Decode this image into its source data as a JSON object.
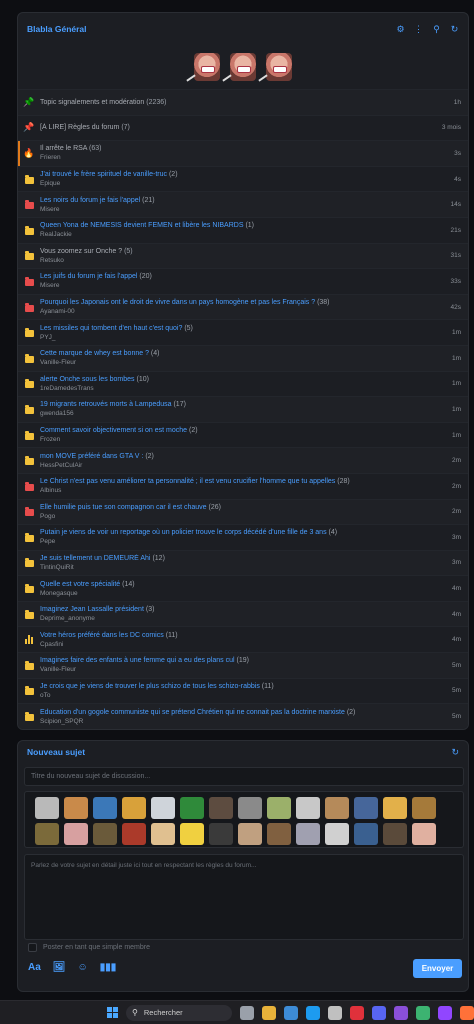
{
  "forum": {
    "title": "Blabla Général",
    "header_icons": [
      "gear-icon",
      "more-vertical-icon",
      "search-icon",
      "refresh-icon"
    ],
    "topics": [
      {
        "icon": "pin-green",
        "title": "Topic signalements et modération",
        "count": "(2236)",
        "author": "",
        "time": "1h",
        "style": "grey"
      },
      {
        "icon": "pin-red",
        "title": "[À LIRE] Règles du forum",
        "count": "(7)",
        "author": "",
        "time": "3 mois",
        "style": "grey"
      },
      {
        "icon": "flame",
        "title": "Il arrête le RSA",
        "count": "(63)",
        "author": "Frieren",
        "time": "3s",
        "style": "grey",
        "active": true
      },
      {
        "icon": "folder-yellow",
        "title": "J'ai trouvé le frère spirituel de vanille-truc",
        "count": "(2)",
        "author": "Epique",
        "time": "4s"
      },
      {
        "icon": "folder-red",
        "title": "Les noirs du forum je fais l'appel",
        "count": "(21)",
        "author": "Misere",
        "time": "14s"
      },
      {
        "icon": "folder-yellow",
        "title": "Queen Yona de NEMESIS devient FEMEN et libère les NIBARDS",
        "count": "(1)",
        "author": "RealJackie",
        "time": "21s"
      },
      {
        "icon": "folder-yellow",
        "title": "Vous zoomez sur Onche ?",
        "count": "(5)",
        "author": "Retsuko",
        "time": "31s",
        "style": "grey"
      },
      {
        "icon": "folder-red",
        "title": "Les juifs du forum je fais l'appel",
        "count": "(20)",
        "author": "Misere",
        "time": "33s"
      },
      {
        "icon": "folder-red",
        "title": "Pourquoi les Japonais ont le droit de vivre dans un pays homogène et pas les Français ?",
        "count": "(38)",
        "author": "Ayanami-00",
        "time": "42s"
      },
      {
        "icon": "folder-yellow",
        "title": "Les missiles qui tombent d'en haut c'est quoi?",
        "count": "(5)",
        "author": "PYJ_",
        "time": "1m"
      },
      {
        "icon": "folder-yellow",
        "title": "Cette marque de whey est bonne ?",
        "count": "(4)",
        "author": "Vanille-Fleur",
        "time": "1m"
      },
      {
        "icon": "folder-yellow",
        "title": "alerte Onche sous les bombes",
        "count": "(10)",
        "author": "1reDamedesTrans",
        "time": "1m"
      },
      {
        "icon": "folder-yellow",
        "title": "19 migrants retrouvés morts à Lampedusa",
        "count": "(17)",
        "author": "gwenda156",
        "time": "1m"
      },
      {
        "icon": "folder-yellow",
        "title": "Comment savoir objectivement si on est moche",
        "count": "(2)",
        "author": "Frozen",
        "time": "1m"
      },
      {
        "icon": "folder-yellow",
        "title": "mon MOVE préféré dans GTA V :",
        "count": "(2)",
        "author": "HessPetCulAir",
        "time": "2m"
      },
      {
        "icon": "folder-red",
        "title": "Le Christ n'est pas venu améliorer ta personnalité ; il est venu crucifier l'homme que tu appelles",
        "count": "(28)",
        "author": "Albinus",
        "time": "2m"
      },
      {
        "icon": "folder-red",
        "title": "Elle humilie puis tue son compagnon car il est chauve",
        "count": "(26)",
        "author": "Pogo",
        "time": "2m"
      },
      {
        "icon": "folder-yellow",
        "title": "Putain je viens de voir un reportage où un policier trouve le corps décédé d'une fille de 3 ans",
        "count": "(4)",
        "author": "Pepe",
        "time": "3m"
      },
      {
        "icon": "folder-yellow",
        "title": "Je suis tellement un DEMEURÉ Ahi",
        "count": "(12)",
        "author": "TintinQuiRit",
        "time": "3m"
      },
      {
        "icon": "folder-yellow",
        "title": "Quelle est votre spécialité",
        "count": "(14)",
        "author": "Monegasque",
        "time": "4m"
      },
      {
        "icon": "folder-yellow",
        "title": "Imaginez Jean Lassalle président",
        "count": "(3)",
        "author": "Deprime_anonyme",
        "time": "4m"
      },
      {
        "icon": "poll",
        "title": "Votre héros préféré dans les DC comics",
        "count": "(11)",
        "author": "Cpasfini",
        "time": "4m"
      },
      {
        "icon": "folder-yellow",
        "title": "Imagines faire des enfants à une femme qui a eu des plans cul",
        "count": "(19)",
        "author": "Vanille-Fleur",
        "time": "5m"
      },
      {
        "icon": "folder-yellow",
        "title": "Je crois que je viens de trouver le plus schizo de tous les schizo-rabbis",
        "count": "(11)",
        "author": "oTo",
        "time": "5m"
      },
      {
        "icon": "folder-yellow",
        "title": "Education d'un gogole communiste qui se prétend Chrétien qui ne connait pas la doctrine marxiste",
        "count": "(2)",
        "author": "Scipion_SPQR",
        "time": "5m"
      }
    ],
    "pager": {
      "prev": "‹",
      "next": "›"
    }
  },
  "new_topic": {
    "title": "Nouveau sujet",
    "title_placeholder": "Titre du nouveau sujet de discussion...",
    "body_placeholder": "Parlez de votre sujet en détail juste ici tout en respectant les règles du forum...",
    "simple_member_label": "Poster en tant que simple membre",
    "tools": [
      "Aa",
      "image-add-icon",
      "emoji-icon",
      "poll-icon"
    ],
    "submit_label": "Envoyer",
    "emoji_colors": [
      "#b9b9b9",
      "#c98a4a",
      "#3b78b8",
      "#d8a13a",
      "#cfd4da",
      "#2f8a3a",
      "#5d4c40",
      "#8a8a8a",
      "#9bb06a",
      "#c8c8c8",
      "#b58a5a",
      "#46669a",
      "#e2b04a",
      "#a57a3a",
      "#7b6a3a",
      "#d7a0a0",
      "#6a5a3a",
      "#ab3a2a",
      "#e0c090",
      "#f0d040",
      "#3a3a3a",
      "#c0a080",
      "#806040",
      "#a0a0b0",
      "#d0d0d0",
      "#3a6090",
      "#5a4a3a",
      "#e0b0a0",
      "#c0c0c0",
      "#9a7a5a",
      "#7a8a9a",
      "#b0a090",
      "#4a4a4a",
      "#c8a070",
      "#8a5a4a",
      "#a0b0c0"
    ]
  },
  "taskbar": {
    "search_label": "Rechercher",
    "app_colors": [
      "#9aa0aa",
      "#e8b23a",
      "#3d8bd6",
      "#1d9bf0",
      "#c0c0c0",
      "#e0313b",
      "#5865f2",
      "#8a4fd8",
      "#3cb371",
      "#9146ff",
      "#ff7139"
    ]
  }
}
